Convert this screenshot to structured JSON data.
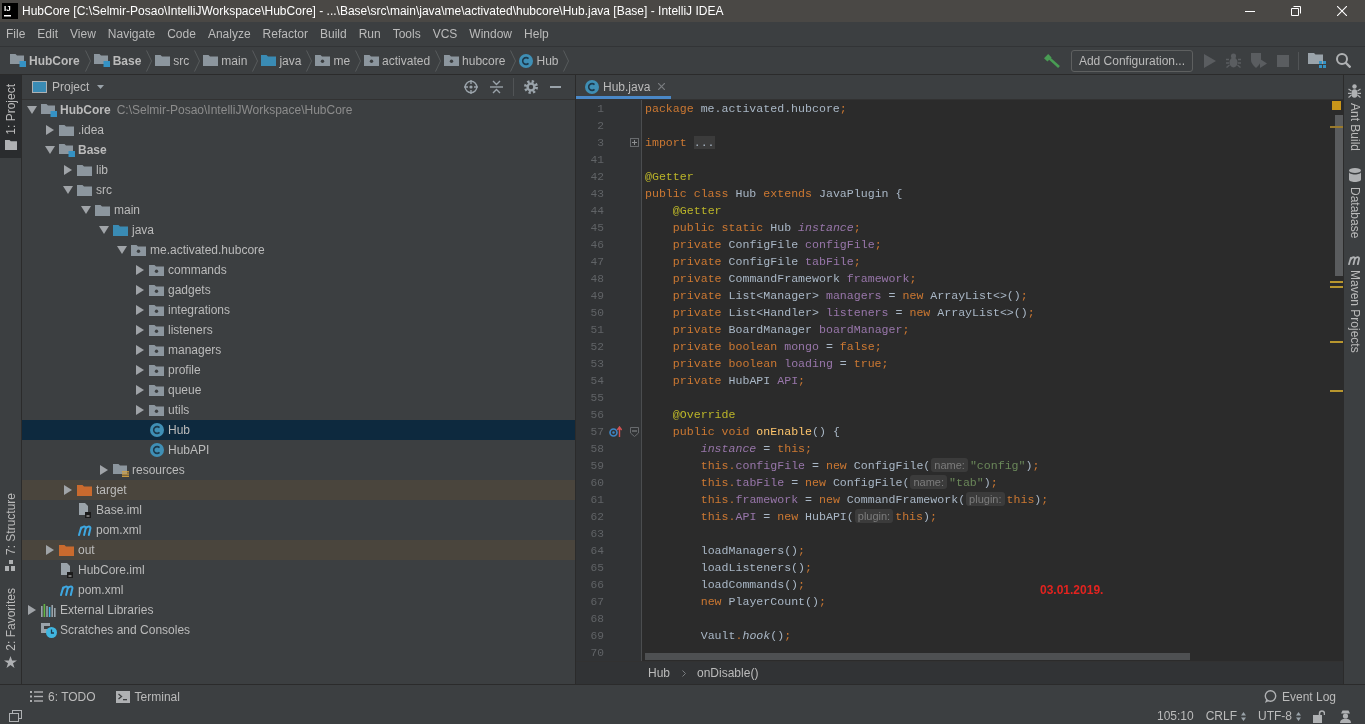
{
  "window": {
    "logo": "IJ",
    "title": "HubCore [C:\\Selmir-Posao\\IntelliJWorkspace\\HubCore] - ...\\Base\\src\\main\\java\\me\\activated\\hubcore\\Hub.java [Base] - IntelliJ IDEA"
  },
  "menu": [
    {
      "label": "File"
    },
    {
      "label": "Edit"
    },
    {
      "label": "View"
    },
    {
      "label": "Navigate"
    },
    {
      "label": "Code"
    },
    {
      "label": "Analyze"
    },
    {
      "label": "Refactor"
    },
    {
      "label": "Build"
    },
    {
      "label": "Run"
    },
    {
      "label": "Tools"
    },
    {
      "label": "VCS"
    },
    {
      "label": "Window"
    },
    {
      "label": "Help"
    }
  ],
  "navigation_bar": {
    "crumbs": [
      {
        "label": "HubCore",
        "kind": "module"
      },
      {
        "label": "Base",
        "kind": "module"
      },
      {
        "label": "src",
        "kind": "folder"
      },
      {
        "label": "main",
        "kind": "folder"
      },
      {
        "label": "java",
        "kind": "source_root"
      },
      {
        "label": "me",
        "kind": "package"
      },
      {
        "label": "activated",
        "kind": "package"
      },
      {
        "label": "hubcore",
        "kind": "package"
      },
      {
        "label": "Hub",
        "kind": "class"
      }
    ],
    "toolbar": [
      {
        "kind": "build",
        "disabled": false
      },
      {
        "kind": "configuration",
        "label": "Add Configuration...",
        "disabled": false
      },
      {
        "kind": "run",
        "disabled": true
      },
      {
        "kind": "debug",
        "disabled": true
      },
      {
        "kind": "coverage",
        "disabled": true
      },
      {
        "kind": "stop",
        "disabled": true
      },
      {
        "kind": "project_structure",
        "disabled": false
      },
      {
        "kind": "search",
        "disabled": false
      }
    ]
  },
  "left_strip": {
    "top": [
      {
        "label": "1: Project",
        "kind": "project",
        "selected": true
      }
    ],
    "bottom": [
      {
        "label": "7: Structure",
        "kind": "structure",
        "selected": false
      },
      {
        "label": "2: Favorites",
        "kind": "favorites",
        "selected": false
      }
    ]
  },
  "project_panel": {
    "title": "Project",
    "tree": [
      {
        "label": "HubCore",
        "path": "C:\\Selmir-Posao\\IntelliJWorkspace\\HubCore",
        "kind": "module",
        "expanded": true,
        "selected": false,
        "children": [
          {
            "label": ".idea",
            "kind": "folder",
            "expanded": false,
            "selected": false
          },
          {
            "label": "Base",
            "kind": "module",
            "expanded": true,
            "selected": false,
            "children": [
              {
                "label": "lib",
                "kind": "folder",
                "expanded": false,
                "selected": false
              },
              {
                "label": "src",
                "kind": "folder",
                "expanded": true,
                "selected": false,
                "children": [
                  {
                    "label": "main",
                    "kind": "folder",
                    "expanded": true,
                    "selected": false,
                    "children": [
                      {
                        "label": "java",
                        "kind": "source_root",
                        "expanded": true,
                        "selected": false,
                        "children": [
                          {
                            "label": "me.activated.hubcore",
                            "kind": "package",
                            "expanded": true,
                            "selected": false,
                            "children": [
                              {
                                "label": "commands",
                                "kind": "package",
                                "expanded": false,
                                "selected": false
                              },
                              {
                                "label": "gadgets",
                                "kind": "package",
                                "expanded": false,
                                "selected": false
                              },
                              {
                                "label": "integrations",
                                "kind": "package",
                                "expanded": false,
                                "selected": false
                              },
                              {
                                "label": "listeners",
                                "kind": "package",
                                "expanded": false,
                                "selected": false
                              },
                              {
                                "label": "managers",
                                "kind": "package",
                                "expanded": false,
                                "selected": false
                              },
                              {
                                "label": "profile",
                                "kind": "package",
                                "expanded": false,
                                "selected": false
                              },
                              {
                                "label": "queue",
                                "kind": "package",
                                "expanded": false,
                                "selected": false
                              },
                              {
                                "label": "utils",
                                "kind": "package",
                                "expanded": false,
                                "selected": false
                              },
                              {
                                "label": "Hub",
                                "kind": "class",
                                "selected": true
                              },
                              {
                                "label": "HubAPI",
                                "kind": "class",
                                "selected": false
                              }
                            ]
                          }
                        ]
                      },
                      {
                        "label": "resources",
                        "kind": "resources_root",
                        "expanded": false,
                        "selected": false
                      }
                    ]
                  }
                ]
              },
              {
                "label": "target",
                "kind": "excluded_folder",
                "expanded": false,
                "selected": false
              },
              {
                "label": "Base.iml",
                "kind": "iml_file",
                "selected": false
              },
              {
                "label": "pom.xml",
                "kind": "maven_file",
                "selected": false
              }
            ]
          },
          {
            "label": "out",
            "kind": "excluded_folder",
            "expanded": false,
            "selected": false
          },
          {
            "label": "HubCore.iml",
            "kind": "iml_file",
            "selected": false
          },
          {
            "label": "pom.xml",
            "kind": "maven_file",
            "selected": false
          }
        ]
      },
      {
        "label": "External Libraries",
        "kind": "libraries",
        "expanded": false,
        "selected": false
      },
      {
        "label": "Scratches and Consoles",
        "kind": "scratches",
        "selected": false
      }
    ]
  },
  "editor": {
    "tabs": [
      {
        "label": "Hub.java",
        "kind": "class",
        "selected": true
      }
    ],
    "inspection": {
      "kind": "warning"
    },
    "lines": [
      {
        "number": "1",
        "tokens": [
          {
            "kind": "keyword",
            "text": "package"
          },
          {
            "kind": "plain",
            "text": " me.activated.hubcore"
          },
          {
            "kind": "keyword",
            "text": ";"
          }
        ]
      },
      {
        "number": "2"
      },
      {
        "number": "3",
        "gutter": [
          {
            "kind": "fold_collapsed"
          }
        ],
        "tokens": [
          {
            "kind": "keyword",
            "text": "import "
          },
          {
            "kind": "folded",
            "text": "..."
          }
        ]
      },
      {
        "number": "41"
      },
      {
        "number": "42",
        "tokens": [
          {
            "kind": "annotation",
            "text": "@Getter"
          }
        ]
      },
      {
        "number": "43",
        "tokens": [
          {
            "kind": "keyword",
            "text": "public class "
          },
          {
            "kind": "plain",
            "text": "Hub "
          },
          {
            "kind": "keyword",
            "text": "extends "
          },
          {
            "kind": "plain",
            "text": "JavaPlugin {"
          }
        ]
      },
      {
        "number": "44",
        "tokens": [
          {
            "kind": "annotation",
            "text": "    @Getter"
          }
        ]
      },
      {
        "number": "45",
        "tokens": [
          {
            "kind": "keyword",
            "text": "    public static "
          },
          {
            "kind": "plain",
            "text": "Hub "
          },
          {
            "kind": "static_field",
            "text": "instance"
          },
          {
            "kind": "keyword",
            "text": ";"
          }
        ]
      },
      {
        "number": "46",
        "tokens": [
          {
            "kind": "keyword",
            "text": "    private "
          },
          {
            "kind": "plain",
            "text": "ConfigFile "
          },
          {
            "kind": "field",
            "text": "configFile"
          },
          {
            "kind": "keyword",
            "text": ";"
          }
        ]
      },
      {
        "number": "47",
        "tokens": [
          {
            "kind": "keyword",
            "text": "    private "
          },
          {
            "kind": "plain",
            "text": "ConfigFile "
          },
          {
            "kind": "field",
            "text": "tabFile"
          },
          {
            "kind": "keyword",
            "text": ";"
          }
        ]
      },
      {
        "number": "48",
        "tokens": [
          {
            "kind": "keyword",
            "text": "    private "
          },
          {
            "kind": "plain",
            "text": "CommandFramework "
          },
          {
            "kind": "field",
            "text": "framework"
          },
          {
            "kind": "keyword",
            "text": ";"
          }
        ]
      },
      {
        "number": "49",
        "tokens": [
          {
            "kind": "keyword",
            "text": "    private "
          },
          {
            "kind": "plain",
            "text": "List<Manager> "
          },
          {
            "kind": "field",
            "text": "managers"
          },
          {
            "kind": "plain",
            "text": " = "
          },
          {
            "kind": "keyword",
            "text": "new "
          },
          {
            "kind": "plain",
            "text": "ArrayList<>()"
          },
          {
            "kind": "keyword",
            "text": ";"
          }
        ]
      },
      {
        "number": "50",
        "tokens": [
          {
            "kind": "keyword",
            "text": "    private "
          },
          {
            "kind": "plain",
            "text": "List<Handler> "
          },
          {
            "kind": "field",
            "text": "listeners"
          },
          {
            "kind": "plain",
            "text": " = "
          },
          {
            "kind": "keyword",
            "text": "new "
          },
          {
            "kind": "plain",
            "text": "ArrayList<>()"
          },
          {
            "kind": "keyword",
            "text": ";"
          }
        ]
      },
      {
        "number": "51",
        "tokens": [
          {
            "kind": "keyword",
            "text": "    private "
          },
          {
            "kind": "plain",
            "text": "BoardManager "
          },
          {
            "kind": "field",
            "text": "boardManager"
          },
          {
            "kind": "keyword",
            "text": ";"
          }
        ]
      },
      {
        "number": "52",
        "tokens": [
          {
            "kind": "keyword",
            "text": "    private boolean "
          },
          {
            "kind": "field",
            "text": "mongo"
          },
          {
            "kind": "plain",
            "text": " = "
          },
          {
            "kind": "keyword",
            "text": "false;"
          }
        ]
      },
      {
        "number": "53",
        "tokens": [
          {
            "kind": "keyword",
            "text": "    private boolean "
          },
          {
            "kind": "field",
            "text": "loading"
          },
          {
            "kind": "plain",
            "text": " = "
          },
          {
            "kind": "keyword",
            "text": "true;"
          }
        ]
      },
      {
        "number": "54",
        "tokens": [
          {
            "kind": "keyword",
            "text": "    private "
          },
          {
            "kind": "plain",
            "text": "HubAPI "
          },
          {
            "kind": "field",
            "text": "API"
          },
          {
            "kind": "keyword",
            "text": ";"
          }
        ]
      },
      {
        "number": "55"
      },
      {
        "number": "56",
        "tokens": [
          {
            "kind": "annotation",
            "text": "    @Override"
          }
        ]
      },
      {
        "number": "57",
        "gutter": [
          {
            "kind": "override_marker"
          },
          {
            "kind": "fold_expanded"
          }
        ],
        "tokens": [
          {
            "kind": "keyword",
            "text": "    public void "
          },
          {
            "kind": "method",
            "text": "onEnable"
          },
          {
            "kind": "plain",
            "text": "() {"
          }
        ]
      },
      {
        "number": "58",
        "tokens": [
          {
            "kind": "static_field",
            "text": "        instance"
          },
          {
            "kind": "plain",
            "text": " = "
          },
          {
            "kind": "keyword",
            "text": "this;"
          }
        ]
      },
      {
        "number": "59",
        "tokens": [
          {
            "kind": "keyword",
            "text": "        this."
          },
          {
            "kind": "field",
            "text": "configFile"
          },
          {
            "kind": "plain",
            "text": " = "
          },
          {
            "kind": "keyword",
            "text": "new "
          },
          {
            "kind": "plain",
            "text": "ConfigFile("
          },
          {
            "kind": "hint",
            "text": "name:"
          },
          {
            "kind": "string",
            "text": "\"config\""
          },
          {
            "kind": "plain",
            "text": ")"
          },
          {
            "kind": "keyword",
            "text": ";"
          }
        ]
      },
      {
        "number": "60",
        "tokens": [
          {
            "kind": "keyword",
            "text": "        this."
          },
          {
            "kind": "field",
            "text": "tabFile"
          },
          {
            "kind": "plain",
            "text": " = "
          },
          {
            "kind": "keyword",
            "text": "new "
          },
          {
            "kind": "plain",
            "text": "ConfigFile("
          },
          {
            "kind": "hint",
            "text": "name:"
          },
          {
            "kind": "string",
            "text": "\"tab\""
          },
          {
            "kind": "plain",
            "text": ")"
          },
          {
            "kind": "keyword",
            "text": ";"
          }
        ]
      },
      {
        "number": "61",
        "tokens": [
          {
            "kind": "keyword",
            "text": "        this."
          },
          {
            "kind": "field",
            "text": "framework"
          },
          {
            "kind": "plain",
            "text": " = "
          },
          {
            "kind": "keyword",
            "text": "new "
          },
          {
            "kind": "plain",
            "text": "CommandFramework("
          },
          {
            "kind": "hint",
            "text": "plugin:"
          },
          {
            "kind": "keyword",
            "text": "this"
          },
          {
            "kind": "plain",
            "text": ")"
          },
          {
            "kind": "keyword",
            "text": ";"
          }
        ]
      },
      {
        "number": "62",
        "tokens": [
          {
            "kind": "keyword",
            "text": "        this."
          },
          {
            "kind": "field",
            "text": "API"
          },
          {
            "kind": "plain",
            "text": " = "
          },
          {
            "kind": "keyword",
            "text": "new "
          },
          {
            "kind": "plain",
            "text": "HubAPI("
          },
          {
            "kind": "hint",
            "text": "plugin:"
          },
          {
            "kind": "keyword",
            "text": "this"
          },
          {
            "kind": "plain",
            "text": ")"
          },
          {
            "kind": "keyword",
            "text": ";"
          }
        ]
      },
      {
        "number": "63"
      },
      {
        "number": "64",
        "tokens": [
          {
            "kind": "plain",
            "text": "        loadManagers()"
          },
          {
            "kind": "keyword",
            "text": ";"
          }
        ]
      },
      {
        "number": "65",
        "tokens": [
          {
            "kind": "plain",
            "text": "        loadListeners()"
          },
          {
            "kind": "keyword",
            "text": ";"
          }
        ]
      },
      {
        "number": "66",
        "tokens": [
          {
            "kind": "plain",
            "text": "        loadCommands()"
          },
          {
            "kind": "keyword",
            "text": ";"
          }
        ]
      },
      {
        "number": "67",
        "tokens": [
          {
            "kind": "keyword",
            "text": "        new "
          },
          {
            "kind": "plain",
            "text": "PlayerCount()"
          },
          {
            "kind": "keyword",
            "text": ";"
          }
        ]
      },
      {
        "number": "68"
      },
      {
        "number": "69",
        "tokens": [
          {
            "kind": "plain",
            "text": "        Vault"
          },
          {
            "kind": "keyword",
            "text": "."
          },
          {
            "kind": "static_call",
            "text": "hook"
          },
          {
            "kind": "plain",
            "text": "()"
          },
          {
            "kind": "keyword",
            "text": ";"
          }
        ]
      },
      {
        "number": "70"
      }
    ],
    "annotation": "03.01.2019.",
    "breadcrumbs": [
      "Hub",
      "onDisable()"
    ]
  },
  "right_strip": {
    "top": [
      {
        "label": "Ant Build",
        "kind": "ant",
        "selected": false
      },
      {
        "label": "Database",
        "kind": "database",
        "selected": false
      },
      {
        "label": "Maven Projects",
        "kind": "maven",
        "selected": false
      }
    ]
  },
  "bottom_bar": {
    "tabs": [
      {
        "label": "6: TODO",
        "kind": "todo",
        "selected": false
      },
      {
        "label": "Terminal",
        "kind": "terminal",
        "selected": false
      }
    ],
    "event_log": "Event Log"
  },
  "status_bar": {
    "caret_position": "105:10",
    "line_separator": "CRLF",
    "encoding": "UTF-8",
    "locked": false
  }
}
